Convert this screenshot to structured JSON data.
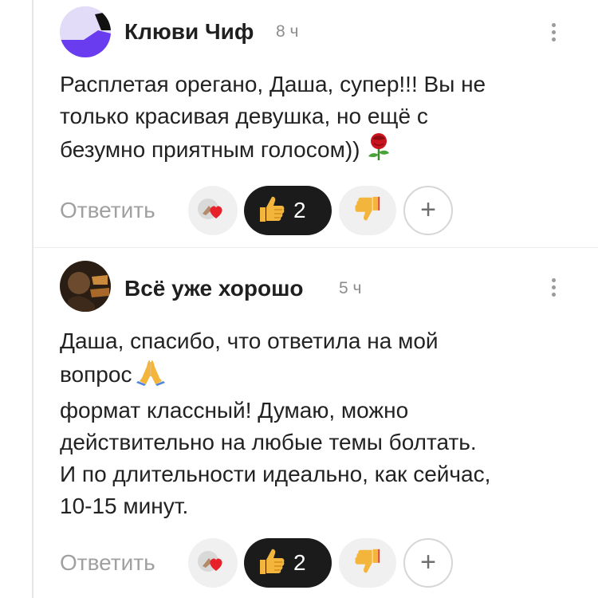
{
  "comments": [
    {
      "author": "Клюви Чиф",
      "time": "8 ч",
      "text_lines": [
        "Расплетая орегано, Даша, супер!!! Вы не",
        "только красивая девушка, но ещё с",
        "безумно приятным голосом))"
      ],
      "reply_label": "Ответить",
      "likes": "2",
      "avatar_colors": [
        "#d9d0f7",
        "#6a3cf0"
      ]
    },
    {
      "author": "Всё уже хорошо",
      "time": "5 ч",
      "text_lines": [
        "Даша, спасибо, что ответила на мой",
        "вопрос",
        "формат классный! Думаю, можно",
        "действительно на любые темы болтать.",
        "И по длительности идеально, как сейчас,",
        "10-15 минут."
      ],
      "reply_label": "Ответить",
      "likes": "2"
    }
  ],
  "icons": {
    "more": "more-vertical-icon",
    "reactions": "reactions-hearts-icon",
    "like": "thumbs-up-icon",
    "dislike": "thumbs-down-icon",
    "add": "plus-icon",
    "rose": "rose-emoji-icon",
    "pray": "praying-hands-emoji-icon"
  },
  "colors": {
    "accent_dark": "#1b1b1b",
    "muted_text": "#a0a0a0",
    "like_emoji": "#f4b53c"
  }
}
